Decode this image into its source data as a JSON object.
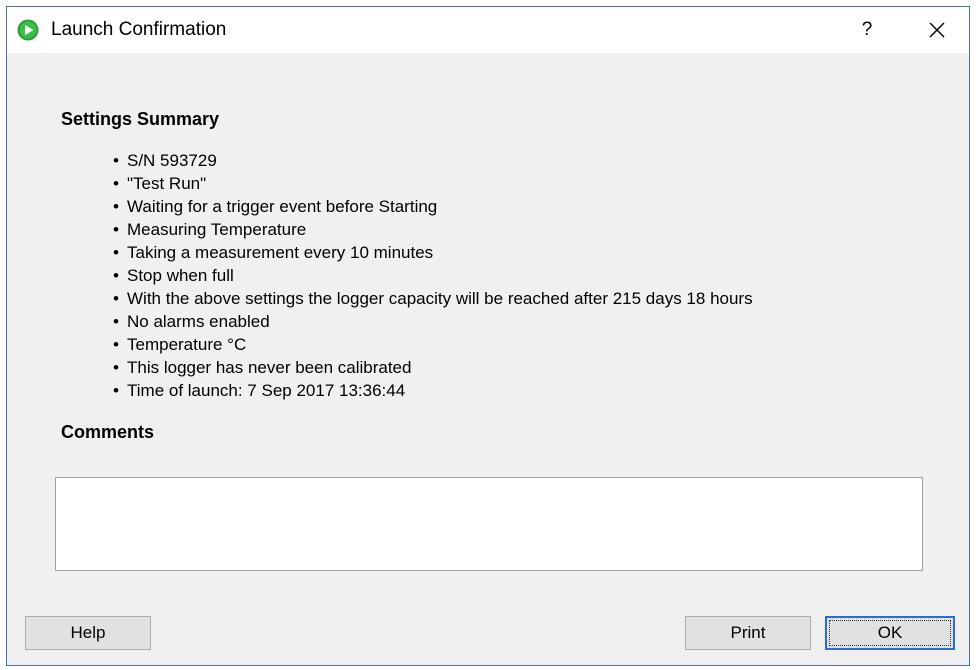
{
  "window": {
    "title": "Launch Confirmation",
    "help_glyph": "?",
    "accent": "#4a6fb0"
  },
  "summary": {
    "heading": "Settings Summary",
    "items": [
      "S/N 593729",
      "\"Test Run\"",
      "Waiting for a trigger event before Starting",
      "Measuring Temperature",
      "Taking a measurement every 10 minutes",
      "Stop when full",
      "With the above settings the logger capacity will be reached after 215 days 18 hours",
      "No alarms enabled",
      "Temperature °C",
      "This logger has never been calibrated",
      "Time of launch: 7 Sep 2017 13:36:44"
    ]
  },
  "comments": {
    "heading": "Comments",
    "value": ""
  },
  "buttons": {
    "help_label": "Help",
    "print_label": "Print",
    "ok_label": "OK"
  },
  "icons": {
    "app": "play-circle-icon",
    "close": "close-icon"
  }
}
